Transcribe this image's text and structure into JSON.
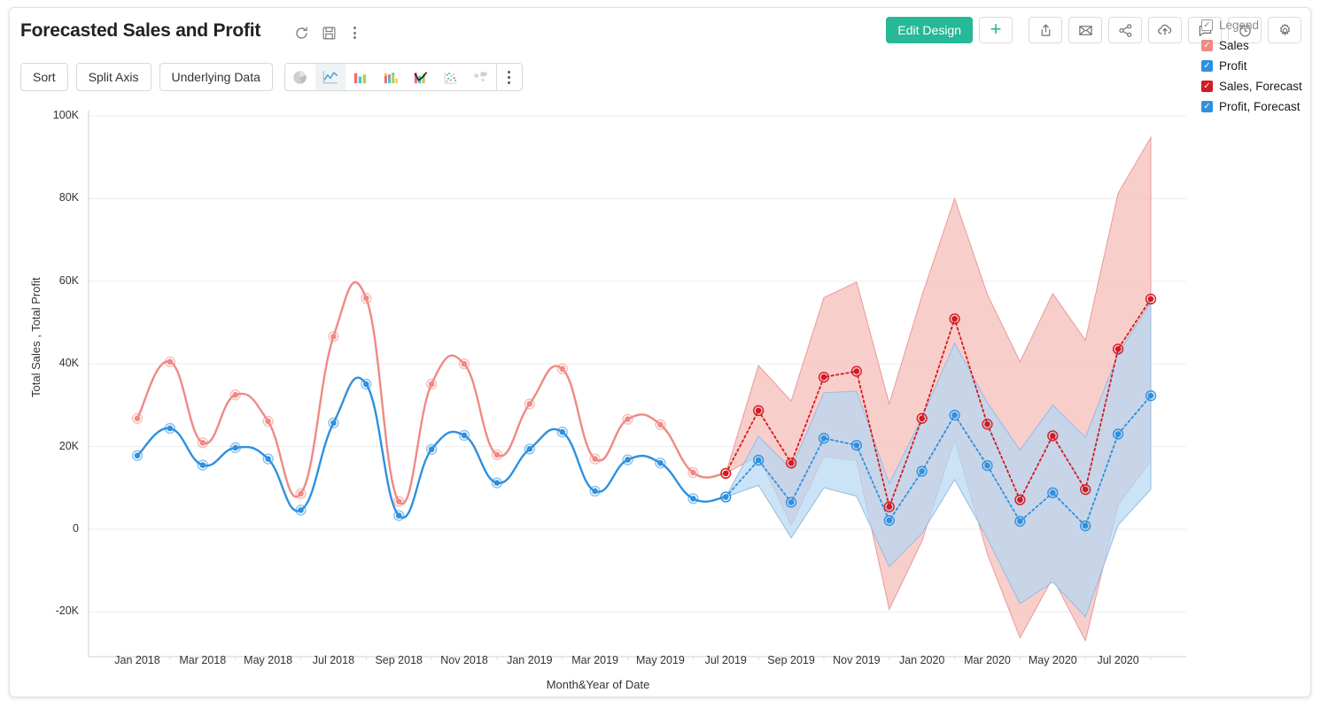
{
  "header": {
    "title": "Forecasted Sales and Profit",
    "icons": [
      {
        "name": "refresh-icon",
        "label": "Refresh"
      },
      {
        "name": "save-icon",
        "label": "Save"
      },
      {
        "name": "more-options-icon",
        "label": "More"
      }
    ],
    "edit_design_label": "Edit Design",
    "accent_color": "#26b897",
    "right_buttons": [
      {
        "name": "add-button",
        "label": "+"
      },
      {
        "name": "export-button",
        "label": "Export"
      },
      {
        "name": "email-button",
        "label": "Email"
      },
      {
        "name": "share-button",
        "label": "Share"
      },
      {
        "name": "publish-button",
        "label": "Publish"
      },
      {
        "name": "comment-button",
        "label": "Comments"
      },
      {
        "name": "alert-button",
        "label": "Alerts"
      },
      {
        "name": "settings-button",
        "label": "Settings"
      }
    ]
  },
  "toolbar": {
    "sort_label": "Sort",
    "split_axis_label": "Split Axis",
    "underlying_data_label": "Underlying Data",
    "chart_types": [
      {
        "name": "pie-chart-icon",
        "label": "Pie",
        "active": false,
        "disabled": true
      },
      {
        "name": "line-chart-icon",
        "label": "Line",
        "active": true,
        "disabled": false
      },
      {
        "name": "bar-chart-icon",
        "label": "Bar",
        "active": false,
        "disabled": false
      },
      {
        "name": "stacked-bar-chart-icon",
        "label": "Stacked Bar",
        "active": false,
        "disabled": false
      },
      {
        "name": "combo-chart-icon",
        "label": "Combo",
        "active": false,
        "disabled": false
      },
      {
        "name": "scatter-chart-icon",
        "label": "Scatter",
        "active": false,
        "disabled": false
      },
      {
        "name": "map-chart-icon",
        "label": "Map",
        "active": false,
        "disabled": true
      }
    ]
  },
  "legend": {
    "title": "Legend",
    "items": [
      {
        "label": "Sales",
        "color": "#ef8a84"
      },
      {
        "label": "Profit",
        "color": "#2e90e0"
      },
      {
        "label": "Sales, Forecast",
        "color": "#d31b22"
      },
      {
        "label": "Profit, Forecast",
        "color": "#2e90e0"
      }
    ]
  },
  "chart_data": {
    "type": "line",
    "title": "Forecasted Sales and Profit",
    "xlabel": "Month&Year of Date",
    "ylabel": "Total Sales , Total Profit",
    "ylim": [
      -30000,
      100000
    ],
    "ytick_labels": [
      "100K",
      "80K",
      "60K",
      "40K",
      "20K",
      "0",
      "-20K"
    ],
    "ytick_values": [
      100000,
      80000,
      60000,
      40000,
      20000,
      0,
      -20000
    ],
    "grid": true,
    "legend_position": "right",
    "x": [
      "Jan 2018",
      "Feb 2018",
      "Mar 2018",
      "Apr 2018",
      "May 2018",
      "Jun 2018",
      "Jul 2018",
      "Aug 2018",
      "Sep 2018",
      "Oct 2018",
      "Nov 2018",
      "Dec 2018",
      "Jan 2019",
      "Feb 2019",
      "Mar 2019",
      "Apr 2019",
      "May 2019",
      "Jun 2019",
      "Jul 2019",
      "Aug 2019",
      "Sep 2019",
      "Oct 2019",
      "Nov 2019",
      "Dec 2019",
      "Jan 2020",
      "Feb 2020",
      "Mar 2020",
      "Apr 2020",
      "May 2020",
      "Jun 2020",
      "Jul 2020",
      "Aug 2020"
    ],
    "xtick_labels": [
      "Jan 2018",
      "Mar 2018",
      "May 2018",
      "Jul 2018",
      "Sep 2018",
      "Nov 2018",
      "Jan 2019",
      "Mar 2019",
      "May 2019",
      "Jul 2019",
      "Sep 2019",
      "Nov 2019",
      "Jan 2020",
      "Mar 2020",
      "May 2020",
      "Jul 2020"
    ],
    "forecast_start_index": 18,
    "series": [
      {
        "name": "Sales",
        "color": "#ef8a84",
        "style": "solid",
        "values": [
          26800,
          40500,
          20900,
          32500,
          26100,
          8600,
          46600,
          55900,
          6700,
          35100,
          40000,
          18000,
          30300,
          38800,
          17000,
          26600,
          25300,
          13700,
          13500,
          null,
          null,
          null,
          null,
          null,
          null,
          null,
          null,
          null,
          null,
          null,
          null,
          null
        ]
      },
      {
        "name": "Profit",
        "color": "#2e90e0",
        "style": "solid",
        "values": [
          17800,
          24400,
          15500,
          19700,
          17000,
          4600,
          25700,
          35100,
          3300,
          19300,
          22700,
          11200,
          19400,
          23500,
          9200,
          16800,
          16000,
          7400,
          7800,
          null,
          null,
          null,
          null,
          null,
          null,
          null,
          null,
          null,
          null,
          null,
          null,
          null
        ]
      },
      {
        "name": "Sales, Forecast",
        "color": "#d31b22",
        "style": "dotted",
        "values": [
          null,
          null,
          null,
          null,
          null,
          null,
          null,
          null,
          null,
          null,
          null,
          null,
          null,
          null,
          null,
          null,
          null,
          null,
          13500,
          28700,
          16000,
          36800,
          38200,
          5400,
          26800,
          50900,
          25400,
          7100,
          22600,
          9600,
          43600,
          55700
        ],
        "band_upper": [
          null,
          null,
          null,
          null,
          null,
          null,
          null,
          null,
          null,
          null,
          null,
          null,
          null,
          null,
          null,
          null,
          null,
          null,
          13500,
          39600,
          31000,
          56000,
          59800,
          30300,
          56500,
          80000,
          56800,
          40500,
          57000,
          45700,
          81300,
          94800
        ],
        "band_lower": [
          null,
          null,
          null,
          null,
          null,
          null,
          null,
          null,
          null,
          null,
          null,
          null,
          null,
          null,
          null,
          null,
          null,
          null,
          13500,
          17800,
          1000,
          17600,
          16600,
          -19400,
          -2900,
          21800,
          -6000,
          -26300,
          -11800,
          -27000,
          5900,
          16600
        ]
      },
      {
        "name": "Profit, Forecast",
        "color": "#2e90e0",
        "style": "dotted",
        "values": [
          null,
          null,
          null,
          null,
          null,
          null,
          null,
          null,
          null,
          null,
          null,
          null,
          null,
          null,
          null,
          null,
          null,
          null,
          7800,
          16700,
          6500,
          22000,
          20300,
          2100,
          14000,
          27600,
          15400,
          1900,
          8800,
          800,
          23000,
          32300
        ],
        "band_upper": [
          null,
          null,
          null,
          null,
          null,
          null,
          null,
          null,
          null,
          null,
          null,
          null,
          null,
          null,
          null,
          null,
          null,
          null,
          7800,
          22500,
          14600,
          33000,
          33400,
          11000,
          27000,
          45000,
          30600,
          19100,
          30000,
          22200,
          42500,
          54900
        ],
        "band_lower": [
          null,
          null,
          null,
          null,
          null,
          null,
          null,
          null,
          null,
          null,
          null,
          null,
          null,
          null,
          null,
          null,
          null,
          null,
          7800,
          10600,
          -2100,
          10000,
          8000,
          -9100,
          -1000,
          12000,
          -2200,
          -18000,
          -12800,
          -21200,
          1000,
          9600
        ]
      }
    ]
  }
}
